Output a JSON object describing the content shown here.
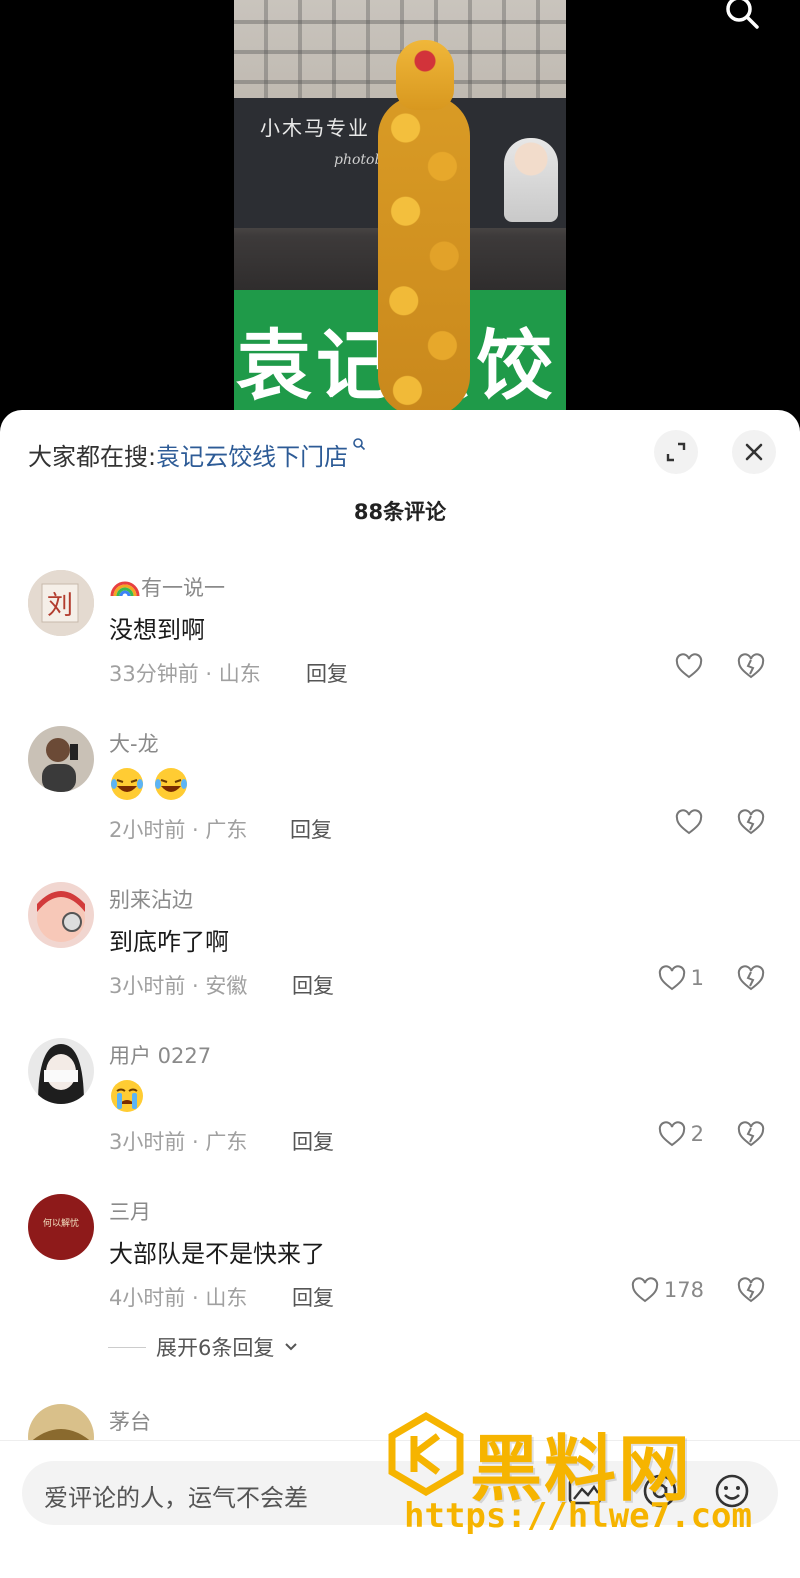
{
  "video": {
    "shop_sign": "小木马专业",
    "shop_sign_sub": "photoby",
    "banner_text": "袁记云饺"
  },
  "header": {
    "trending_prefix": "大家都在搜:",
    "trending_query": "袁记云饺线下门店",
    "comment_count": "88条评论"
  },
  "comments": [
    {
      "username": "有一说一",
      "text": "没想到啊",
      "meta": "33分钟前 · 山东",
      "reply": "回复",
      "likes": ""
    },
    {
      "username": "大-龙",
      "text": "",
      "meta": "2小时前 · 广东",
      "reply": "回复",
      "likes": ""
    },
    {
      "username": "别来沾边",
      "text": "到底咋了啊",
      "meta": "3小时前 · 安徽",
      "reply": "回复",
      "likes": "1"
    },
    {
      "username": "用户 0227",
      "text": "",
      "meta": "3小时前 · 广东",
      "reply": "回复",
      "likes": "2"
    },
    {
      "username": "三月",
      "text": "大部队是不是快来了",
      "meta": "4小时前 · 山东",
      "reply": "回复",
      "likes": "178"
    },
    {
      "username": "茅台",
      "text": "",
      "meta": "",
      "reply": "",
      "likes": ""
    }
  ],
  "expand_replies": "展开6条回复",
  "avatar_text": {
    "first": "刘",
    "fifth": "何以解忧"
  },
  "input": {
    "placeholder": "爱评论的人，运气不会差"
  },
  "watermark": {
    "text": "黑料网",
    "url": "https://hlwe7.com"
  },
  "colors": {
    "link": "#2d5b96",
    "watermark": "#f6b400",
    "banner_green": "#1f9a49"
  }
}
